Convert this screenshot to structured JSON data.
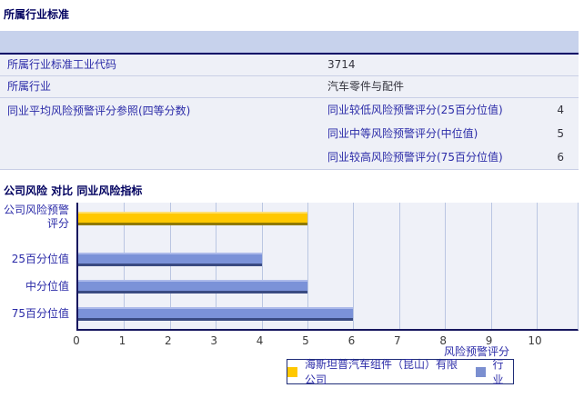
{
  "industry_section": {
    "title": "所属行业标准",
    "rows": [
      {
        "label": "所属行业标准工业代码",
        "value": "3714"
      },
      {
        "label": "所属行业",
        "value": "汽车零件与配件"
      },
      {
        "label": "同业平均风险预警评分参照(四等分数)",
        "subrows": [
          {
            "label": "同业较低风险预警评分(25百分位值)",
            "value": "4"
          },
          {
            "label": "同业中等风险预警评分(中位值)",
            "value": "5"
          },
          {
            "label": "同业较高风险预警评分(75百分位值)",
            "value": "6"
          }
        ]
      }
    ]
  },
  "comparison_section": {
    "title": "公司风险 对比 同业风险指标"
  },
  "chart_data": {
    "type": "bar",
    "orientation": "horizontal",
    "title": "",
    "categories": [
      "公司风险预警评分",
      "25百分位值",
      "中分位值",
      "75百分位值"
    ],
    "series": [
      {
        "name": "海斯坦普汽车组件（昆山）有限公司",
        "color": "#FFC800",
        "values": [
          5,
          null,
          null,
          null
        ]
      },
      {
        "name": "行业",
        "color": "#7B92D8",
        "values": [
          null,
          4,
          5,
          6
        ]
      }
    ],
    "xlabel": "风险预警评分",
    "ylabel": "",
    "xlim": [
      0,
      10
    ],
    "xticks": [
      0,
      1,
      2,
      3,
      4,
      5,
      6,
      7,
      8,
      9,
      10
    ],
    "grid": true,
    "legend_position": "bottom-right"
  },
  "colors": {
    "header_band": "#C7D2EC",
    "row_bg": "#EEF0F7",
    "accent_navy": "#000066",
    "label_blue": "#2B2BA8",
    "company_bar": "#FFC800",
    "industry_bar": "#7B92D8"
  }
}
